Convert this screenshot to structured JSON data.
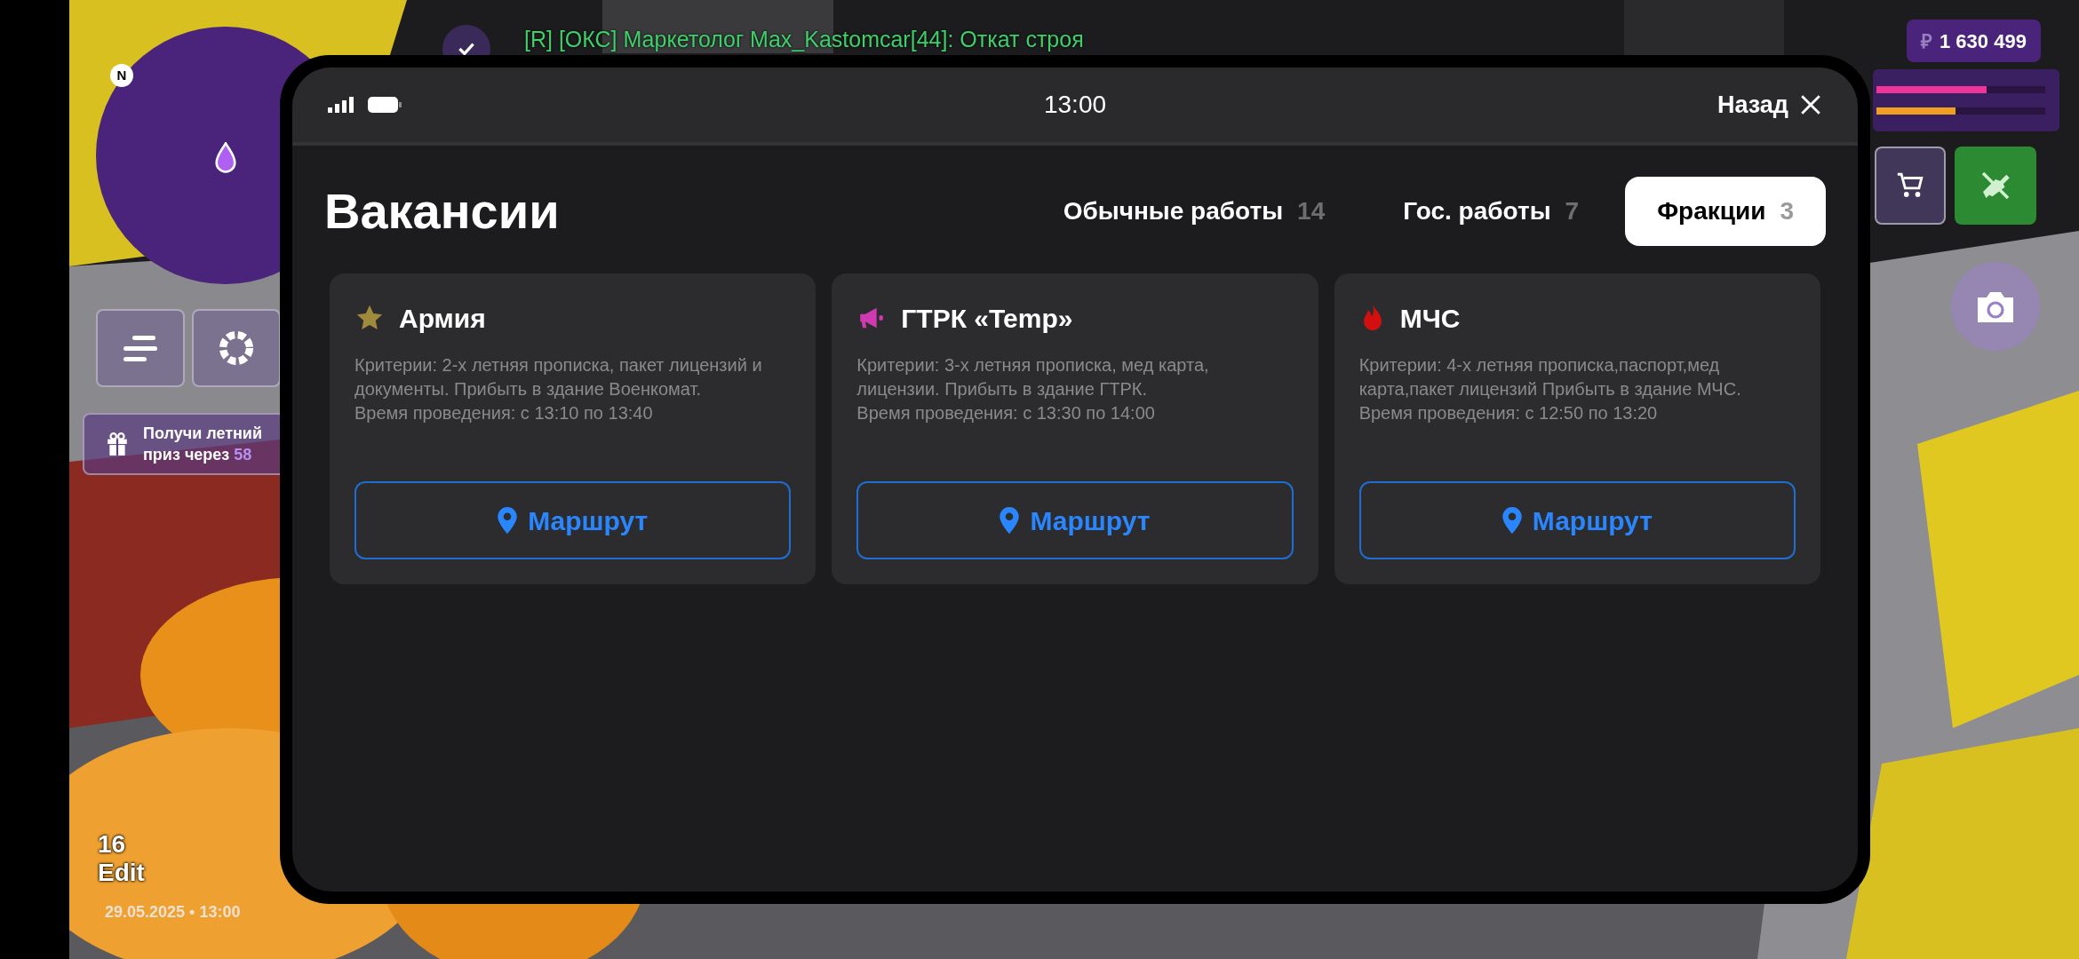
{
  "hud": {
    "compass": "N",
    "chat": "[R] [ОКС] Маркетолог Max_Kastomcar[44]: Откат строя",
    "currency": "₽",
    "money": "1 630 499",
    "bars": [
      {
        "kind": "health",
        "level": 0.65
      },
      {
        "kind": "armor",
        "level": 0.47
      }
    ],
    "gift": {
      "text": "Получи летний",
      "prefix": "приз через",
      "count": "58"
    },
    "level": "16",
    "edit": "Edit",
    "date": "29.05.2025 • 13:00"
  },
  "phone": {
    "time": "13:00",
    "back": "Назад",
    "title": "Вакансии",
    "tabs": [
      {
        "label": "Обычные работы",
        "count": "14",
        "selected": false
      },
      {
        "label": "Гос. работы",
        "count": "7",
        "selected": false
      },
      {
        "label": "Фракции",
        "count": "3",
        "selected": true
      }
    ],
    "cards": [
      {
        "kind": "star",
        "title": "Армия",
        "text": "Критерии: 2-х летняя прописка, пакет лицензий и документы. Прибыть в здание Военкомат.",
        "time": "Время проведения: с 13:10 по 13:40",
        "route": "Маршрут"
      },
      {
        "kind": "megaphone",
        "title": "ГТРК «Temp»",
        "text": "Критерии: 3-х летняя прописка, мед карта, лицензии. Прибыть в здание ГТРК.",
        "time": "Время проведения: с 13:30 по 14:00",
        "route": "Маршрут"
      },
      {
        "kind": "flame",
        "title": "МЧС",
        "text": "Критерии: 4-х летняя прописка,паспорт,мед карта,пакет лицензий Прибыть в здание МЧС.",
        "time": "Время проведения: с 12:50 по 13:20",
        "route": "Маршрут"
      }
    ]
  }
}
